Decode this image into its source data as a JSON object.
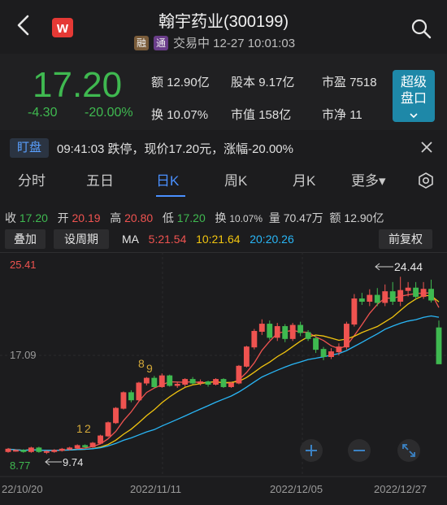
{
  "header": {
    "title": "翰宇药业(300199)",
    "logo_text": "w",
    "tags": [
      "融",
      "通"
    ],
    "status": "交易中 12-27 10:01:03"
  },
  "quote": {
    "price": "17.20",
    "change": "-4.30",
    "change_pct": "-20.00%",
    "stats": [
      {
        "label": "额",
        "value": "12.90亿"
      },
      {
        "label": "股本",
        "value": "9.17亿"
      },
      {
        "label": "市盈",
        "value": "7518"
      },
      {
        "label": "换",
        "value": "10.07%"
      },
      {
        "label": "市值",
        "value": "158亿"
      },
      {
        "label": "市净",
        "value": "11"
      }
    ],
    "super_button": [
      "超级",
      "盘口"
    ]
  },
  "monitor": {
    "tag": "盯盘",
    "text": "09:41:03 跌停，现价17.20元，涨幅-20.00%"
  },
  "tabs": [
    "分时",
    "五日",
    "日K",
    "周K",
    "月K",
    "更多▾"
  ],
  "ohlc": {
    "close_label": "收",
    "close": "17.20",
    "open_label": "开",
    "open": "20.19",
    "high_label": "高",
    "high": "20.80",
    "low_label": "低",
    "low": "17.20",
    "turnover_label": "换",
    "turnover": "10.07%",
    "volume_label": "量",
    "volume": "70.47万",
    "amount_label": "额",
    "amount": "12.90亿"
  },
  "toolbar": {
    "overlay": "叠加",
    "period": "设周期",
    "adjust": "前复权",
    "ma_label": "MA",
    "ma5": "5:21.54",
    "ma10": "10:21.64",
    "ma20": "20:20.26"
  },
  "chart_data": {
    "type": "candlestick",
    "y_top_label": "25.41",
    "y_mid_label": "17.09",
    "y_bottom_label": "8.77",
    "high_annot": "24.44",
    "low_annot": "9.74",
    "seq_labels": [
      "1",
      "2",
      "8",
      "9"
    ],
    "x_labels": [
      "22/10/20",
      "2022/11/11",
      "2022/12/05",
      "2022/12/27"
    ],
    "colors": {
      "up": "#ef5350",
      "down": "#3fb950",
      "ma5": "#ef5350",
      "ma10": "#f1c40f",
      "ma20": "#29b6f6"
    },
    "candles": [
      [
        9.9,
        10.1,
        9.8,
        10.2
      ],
      [
        10.0,
        10.0,
        9.9,
        10.1
      ],
      [
        10.0,
        9.9,
        9.8,
        10.1
      ],
      [
        9.9,
        10.2,
        9.8,
        10.3
      ],
      [
        10.2,
        9.9,
        9.8,
        10.3
      ],
      [
        9.9,
        9.9,
        9.7,
        10.0
      ],
      [
        9.9,
        10.0,
        9.8,
        10.1
      ],
      [
        10.0,
        10.1,
        9.9,
        10.2
      ],
      [
        10.1,
        10.2,
        10.0,
        10.3
      ],
      [
        10.2,
        10.4,
        10.1,
        10.5
      ],
      [
        10.4,
        10.3,
        10.2,
        10.5
      ],
      [
        10.3,
        10.6,
        10.2,
        10.7
      ],
      [
        10.6,
        11.2,
        10.5,
        11.3
      ],
      [
        11.2,
        12.3,
        11.1,
        12.4
      ],
      [
        12.3,
        13.5,
        12.2,
        13.6
      ],
      [
        13.5,
        14.8,
        13.4,
        14.9
      ],
      [
        14.8,
        14.2,
        14.0,
        15.0
      ],
      [
        14.2,
        15.6,
        14.1,
        15.7
      ],
      [
        15.6,
        16.0,
        15.4,
        16.1
      ],
      [
        16.0,
        15.3,
        15.2,
        16.2
      ],
      [
        15.3,
        16.2,
        15.2,
        16.4
      ],
      [
        16.2,
        15.4,
        15.3,
        16.3
      ],
      [
        15.4,
        15.5,
        15.2,
        15.7
      ],
      [
        15.5,
        15.9,
        15.3,
        16.0
      ],
      [
        15.9,
        15.6,
        15.5,
        16.1
      ],
      [
        15.6,
        15.7,
        15.4,
        15.9
      ],
      [
        15.7,
        15.5,
        15.3,
        15.8
      ],
      [
        15.5,
        15.9,
        15.4,
        16.0
      ],
      [
        15.9,
        15.3,
        15.2,
        16.0
      ],
      [
        15.3,
        15.6,
        15.2,
        15.7
      ],
      [
        15.6,
        17.0,
        15.5,
        17.1
      ],
      [
        17.0,
        18.6,
        16.9,
        18.7
      ],
      [
        18.6,
        19.9,
        18.4,
        20.1
      ],
      [
        19.9,
        20.5,
        19.6,
        20.9
      ],
      [
        20.5,
        19.4,
        19.2,
        20.8
      ],
      [
        19.4,
        20.3,
        19.1,
        20.6
      ],
      [
        20.3,
        19.3,
        19.0,
        20.5
      ],
      [
        19.3,
        20.4,
        19.1,
        20.6
      ],
      [
        20.4,
        19.8,
        19.5,
        20.7
      ],
      [
        19.8,
        19.3,
        19.1,
        20.0
      ],
      [
        19.3,
        18.4,
        18.1,
        19.5
      ],
      [
        18.4,
        17.8,
        17.5,
        18.6
      ],
      [
        17.8,
        18.2,
        17.6,
        18.5
      ],
      [
        18.2,
        18.6,
        17.9,
        18.9
      ],
      [
        18.6,
        20.5,
        18.4,
        20.7
      ],
      [
        20.5,
        22.6,
        20.3,
        23.0
      ],
      [
        22.6,
        22.4,
        22.1,
        23.1
      ],
      [
        22.4,
        22.9,
        22.0,
        23.4
      ],
      [
        22.9,
        22.3,
        22.0,
        23.5
      ],
      [
        22.3,
        23.2,
        22.0,
        23.8
      ],
      [
        23.2,
        22.4,
        22.1,
        24.0
      ],
      [
        22.4,
        23.3,
        22.0,
        24.44
      ],
      [
        23.3,
        23.5,
        22.8,
        24.0
      ],
      [
        23.5,
        22.8,
        22.5,
        24.0
      ],
      [
        22.8,
        23.4,
        22.6,
        24.0
      ],
      [
        23.4,
        22.5,
        22.3,
        24.2
      ],
      [
        20.19,
        17.2,
        17.2,
        20.8
      ]
    ]
  }
}
